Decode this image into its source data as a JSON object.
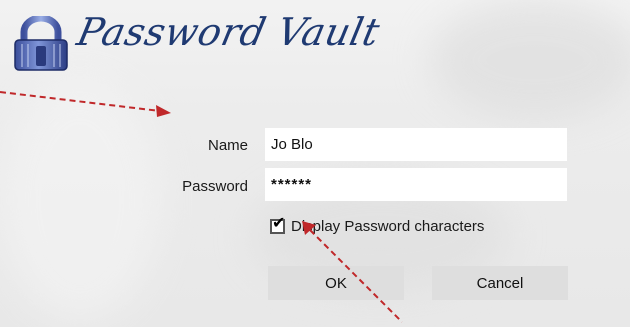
{
  "app": {
    "title": "Password Vault"
  },
  "form": {
    "name_label": "Name",
    "name_value": "Jo Blo",
    "password_label": "Password",
    "password_value": "******",
    "checkbox_label": "Display Password characters",
    "checkbox_checked": true
  },
  "buttons": {
    "ok": "OK",
    "cancel": "Cancel"
  },
  "colors": {
    "title": "#1f3a72",
    "arrow": "#c0282a",
    "button_bg": "#dedede"
  },
  "icons": {
    "logo": "lock-icon",
    "check": "checkmark-icon"
  }
}
